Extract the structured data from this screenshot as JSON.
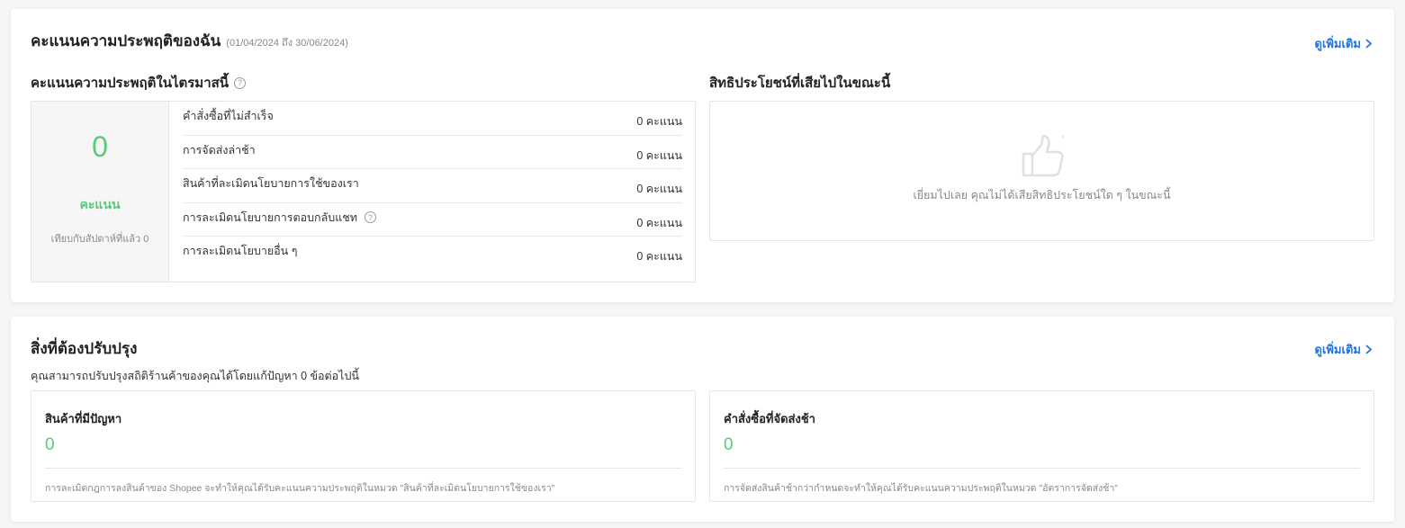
{
  "performance": {
    "title": "คะแนนความประพฤติของฉัน",
    "date_range": "(01/04/2024 ถึง 30/06/2024)",
    "more_label": "ดูเพิ่มเติม",
    "recent": {
      "title": "คะแนนความประพฤติในไตรมาสนี้",
      "help_glyph": "?",
      "total_value": "0",
      "total_unit": "คะแนน",
      "compare_text": "เทียบกับสัปดาห์ที่แล้ว 0",
      "rows": [
        {
          "label": "คำสั่งซื้อที่ไม่สำเร็จ",
          "value": "0 คะแนน"
        },
        {
          "label": "การจัดส่งล่าช้า",
          "value": "0 คะแนน"
        },
        {
          "label": "สินค้าที่ละเมิดนโยบายการใช้ของเรา",
          "value": "0 คะแนน"
        },
        {
          "label": "การละเมิดนโยบายการตอบกลับแชท",
          "value": "0 คะแนน"
        },
        {
          "label": "การละเมิดนโยบายอื่น ๆ",
          "value": "0 คะแนน"
        }
      ]
    },
    "benefits": {
      "title": "สิทธิประโยชน์ที่เสียไปในขณะนี้",
      "icon": "thumbs-up-icon",
      "empty_message": "เยี่ยมไปเลย คุณไม่ได้เสียสิทธิประโยชน์ใด ๆ ในขณะนี้"
    }
  },
  "improve": {
    "title": "สิ่งที่ต้องปรับปรุง",
    "more_label": "ดูเพิ่มเติม",
    "subtitle": "คุณสามารถปรับปรุงสถิติร้านค้าของคุณได้โดยแก้ปัญหา 0 ข้อต่อไปนี้",
    "cards": [
      {
        "title": "สินค้าที่มีปัญหา",
        "value": "0",
        "note": "การละเมิดกฎการลงสินค้าของ Shopee จะทำให้คุณได้รับคะแนนความประพฤติในหมวด \"สินค้าที่ละเมิดนโยบายการใช้ของเรา\""
      },
      {
        "title": "คำสั่งซื้อที่จัดส่งช้า",
        "value": "0",
        "note": "การจัดส่งสินค้าช้ากว่ากำหนดจะทำให้คุณได้รับคะแนนความประพฤติในหมวด \"อัตราการจัดส่งช้า\""
      }
    ]
  },
  "colors": {
    "accent_link": "#2673dd",
    "success_green": "#55cc77"
  }
}
